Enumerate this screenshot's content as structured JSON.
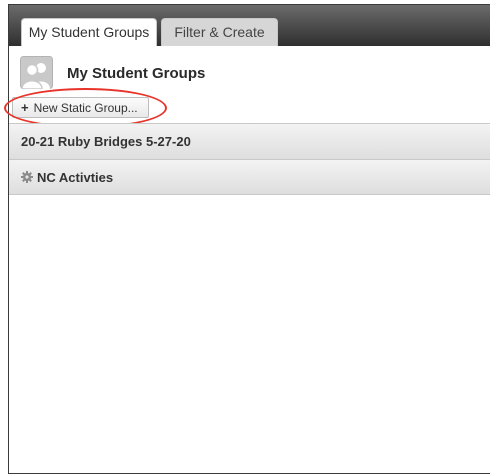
{
  "tabs": [
    {
      "label": "My Student Groups",
      "active": true
    },
    {
      "label": "Filter & Create",
      "active": false
    }
  ],
  "header": {
    "icon": "user-group-icon",
    "title": "My Student Groups"
  },
  "toolbar": {
    "new_group_label": "New Static Group...",
    "new_group_icon": "plus-icon",
    "highlight_color": "#e8332a"
  },
  "groups": [
    {
      "name": "20-21 Ruby Bridges 5-27-20",
      "icon": null
    },
    {
      "name": "NC Activties",
      "icon": "gear-icon"
    }
  ]
}
